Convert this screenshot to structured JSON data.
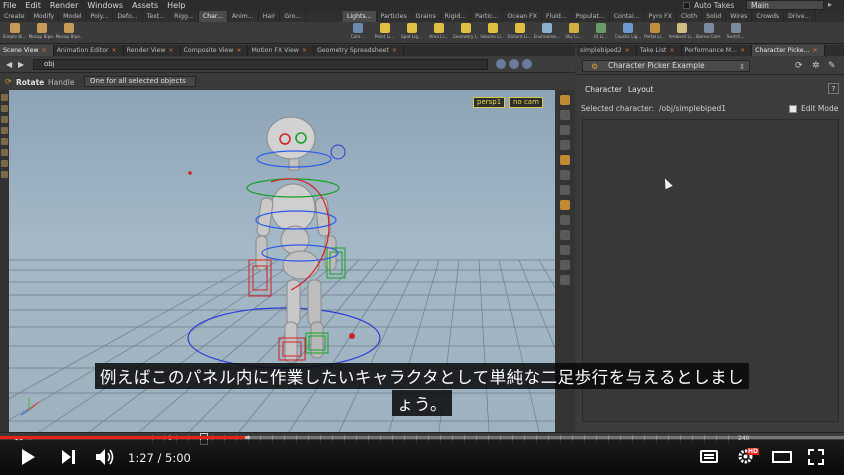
{
  "menubar": {
    "items": [
      "File",
      "Edit",
      "Render",
      "Windows",
      "Assets",
      "Help"
    ],
    "auto_takes": "Auto Takes",
    "take": "Main"
  },
  "shelf_left": {
    "tabs": [
      "Create",
      "Modify",
      "Model",
      "Poly...",
      "Defo...",
      "Text...",
      "Rigg...",
      "Char...",
      "Anim...",
      "Hair",
      "Gro..."
    ],
    "active_tab": 7,
    "tools": [
      {
        "label": "Simple Bi...",
        "color": "#c89a5a"
      },
      {
        "label": "Mocap Bipe...",
        "color": "#c89a5a"
      },
      {
        "label": "Mocap Bipe...",
        "color": "#c89a5a"
      }
    ]
  },
  "shelf_right": {
    "tabs": [
      "Lights...",
      "Particles",
      "Grains",
      "Rigid...",
      "Partic...",
      "Ocean FX",
      "Fluid...",
      "Populat...",
      "Contai...",
      "Pyro FX",
      "Cloth",
      "Solid",
      "Wires",
      "Crowds",
      "Drive..."
    ],
    "active_tab": 0,
    "tools": [
      {
        "label": "Cam...",
        "color": "#6a8ab0"
      },
      {
        "label": "Point Li...",
        "color": "#e0c040"
      },
      {
        "label": "Spot Lig...",
        "color": "#e0c040"
      },
      {
        "label": "Area Li...",
        "color": "#e0c040"
      },
      {
        "label": "Geometry L...",
        "color": "#e0c040"
      },
      {
        "label": "Volume Li...",
        "color": "#e0c040"
      },
      {
        "label": "Distant Li...",
        "color": "#e0c040"
      },
      {
        "label": "Environme...",
        "color": "#8ab0d0"
      },
      {
        "label": "Sky Li...",
        "color": "#d0b040"
      },
      {
        "label": "GI Li...",
        "color": "#6a9a6a"
      },
      {
        "label": "Caustic Lig...",
        "color": "#6a9ad0"
      },
      {
        "label": "Portal Li...",
        "color": "#c09040"
      },
      {
        "label": "Ambient Li...",
        "color": "#d0c080"
      },
      {
        "label": "Stereo Cam...",
        "color": "#7a8aa0"
      },
      {
        "label": "Switch...",
        "color": "#7a8aa0"
      }
    ]
  },
  "pane_tabs_left": [
    "Scene View",
    "Animation Editor",
    "Render View",
    "Composite View",
    "Motion FX View",
    "Geometry Spreadsheet"
  ],
  "pane_tabs_right": [
    "simplebiped2",
    "Take List",
    "Performance M...",
    "Character Picke..."
  ],
  "pathbar": {
    "path": "obj"
  },
  "tool_options": {
    "tool": "Rotate",
    "mode": "Handle",
    "option": "One for all selected objects"
  },
  "viewport": {
    "camera_menu": "persp1",
    "cam_menu": "no cam"
  },
  "panel": {
    "type_select": "Character Picker Example",
    "tab_character": "Character",
    "tab_layout": "Layout",
    "help": "?",
    "selected_label": "Selected character:",
    "selected_value": "/obj/simplebiped1",
    "edit_mode_label": "Edit Mode"
  },
  "subtitle": {
    "line1": "例えばこのパネル内に作業したいキャラクタとして単純な二足歩行を与えるとしまし",
    "line2": "ょう。"
  },
  "timeline": {
    "frame_start": "1",
    "frame_end": "240"
  },
  "video": {
    "current_time": "1:27",
    "separator": " / ",
    "duration": "5:00",
    "progress_fraction": 0.29,
    "hd_badge": "HD"
  }
}
